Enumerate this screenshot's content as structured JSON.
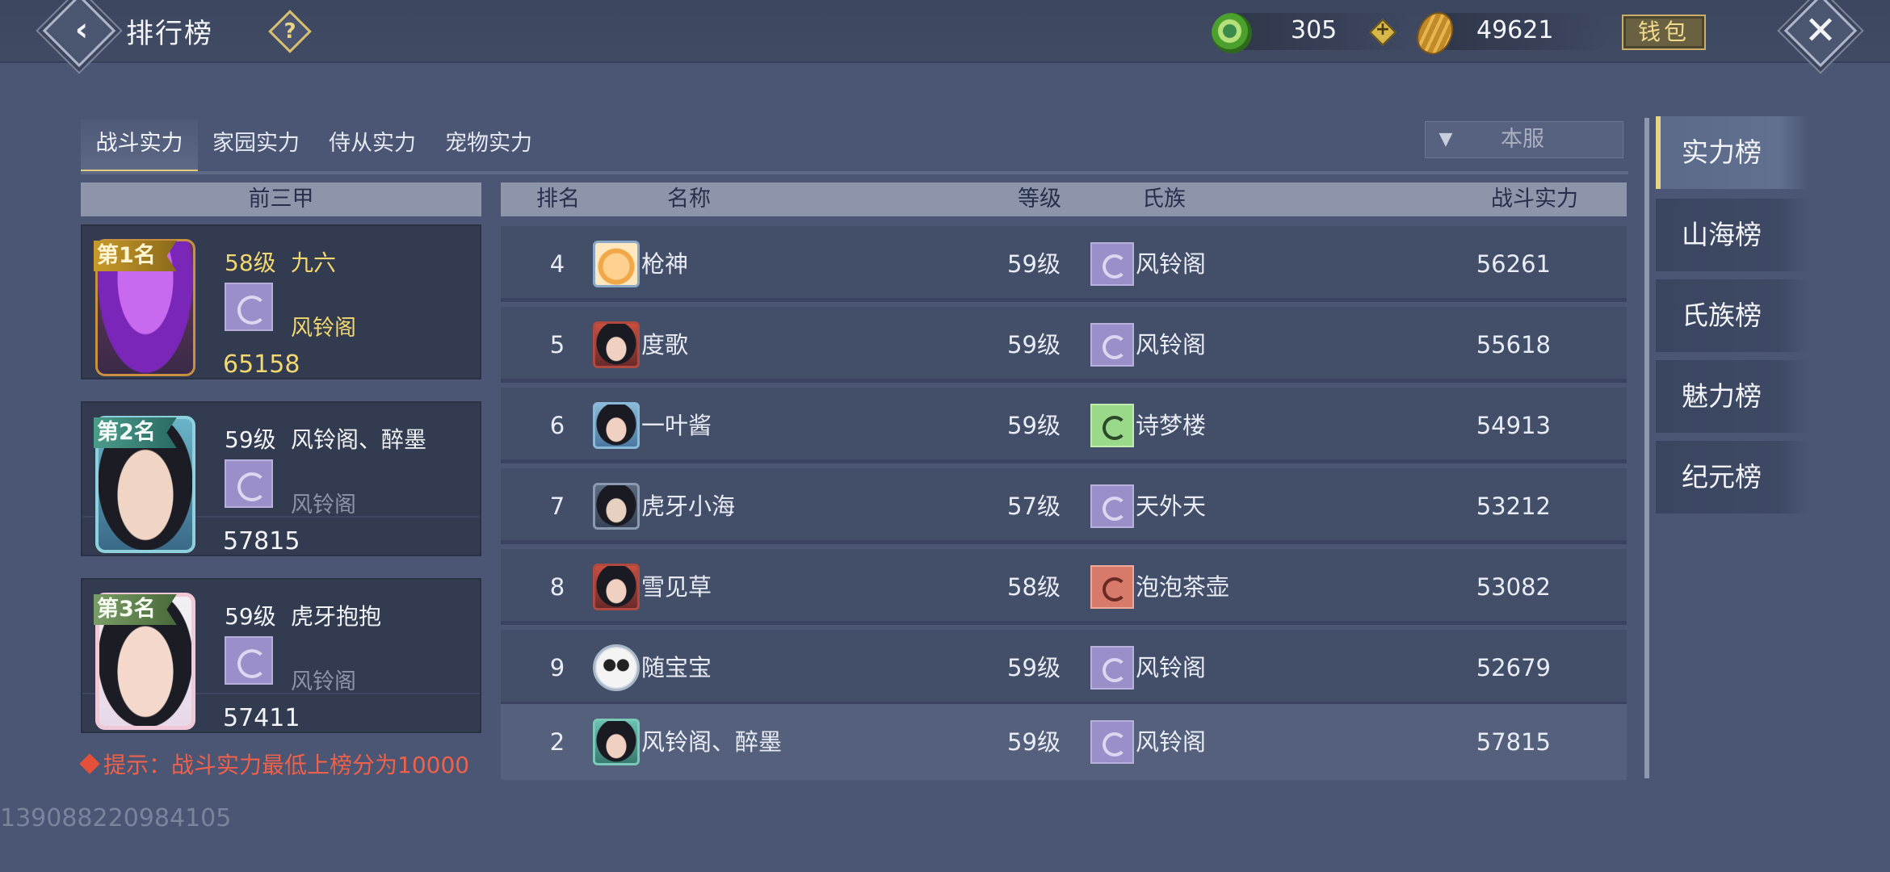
{
  "header": {
    "title": "排行榜",
    "jade_value": "305",
    "gold_value": "49621",
    "wallet_label": "钱包"
  },
  "tabs": [
    {
      "label": "战斗实力",
      "active": true
    },
    {
      "label": "家园实力",
      "active": false
    },
    {
      "label": "侍从实力",
      "active": false
    },
    {
      "label": "宠物实力",
      "active": false
    }
  ],
  "server_filter": {
    "value": "本服"
  },
  "top3": {
    "header": "前三甲",
    "cards": [
      {
        "rank_label": "第1名",
        "level": "58级",
        "name": "九六",
        "clan": "风铃阁",
        "score": "65158"
      },
      {
        "rank_label": "第2名",
        "level": "59级",
        "name": "风铃阁、醉墨",
        "clan": "风铃阁",
        "score": "57815"
      },
      {
        "rank_label": "第3名",
        "level": "59级",
        "name": "虎牙抱抱",
        "clan": "风铃阁",
        "score": "57411"
      }
    ]
  },
  "table": {
    "columns": {
      "rank": "排名",
      "name": "名称",
      "level": "等级",
      "clan": "氏族",
      "power": "战斗实力"
    },
    "rows": [
      {
        "rank": "4",
        "name": "枪神",
        "level": "59级",
        "clan": "风铃阁",
        "power": "56261",
        "avatar": "cartoon-avatar",
        "clan_color": "purple"
      },
      {
        "rank": "5",
        "name": "度歌",
        "level": "59级",
        "clan": "风铃阁",
        "power": "55618",
        "avatar": "girl-avatar",
        "clan_color": "purple"
      },
      {
        "rank": "6",
        "name": "一叶酱",
        "level": "59级",
        "clan": "诗梦楼",
        "power": "54913",
        "avatar": "girl-avatar",
        "clan_color": "green"
      },
      {
        "rank": "7",
        "name": "虎牙小海",
        "level": "57级",
        "clan": "天外天",
        "power": "53212",
        "avatar": "cat-girl-avatar",
        "clan_color": "purple"
      },
      {
        "rank": "8",
        "name": "雪见草",
        "level": "58级",
        "clan": "泡泡茶壶",
        "power": "53082",
        "avatar": "girl-avatar",
        "clan_color": "red"
      },
      {
        "rank": "9",
        "name": "随宝宝",
        "level": "59级",
        "clan": "风铃阁",
        "power": "52679",
        "avatar": "panda-avatar",
        "clan_color": "purple"
      }
    ],
    "my_row": {
      "rank": "2",
      "name": "风铃阁、醉墨",
      "level": "59级",
      "clan": "风铃阁",
      "power": "57815",
      "avatar": "girl-avatar",
      "clan_color": "purple"
    }
  },
  "hint": "提示：战斗实力最低上榜分为10000",
  "uid": "13908822098410​5",
  "side_nav": [
    {
      "label": "实力榜",
      "active": true
    },
    {
      "label": "山海榜",
      "active": false
    },
    {
      "label": "氏族榜",
      "active": false
    },
    {
      "label": "魅力榜",
      "active": false
    },
    {
      "label": "纪元榜",
      "active": false
    }
  ]
}
